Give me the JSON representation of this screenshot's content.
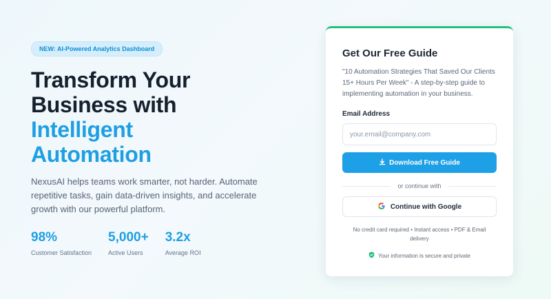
{
  "hero": {
    "badge": "NEW: AI-Powered Analytics Dashboard",
    "headline_line1": "Transform Your",
    "headline_line2": "Business with",
    "headline_accent1": "Intelligent",
    "headline_accent2": "Automation",
    "description": "NexusAI helps teams work smarter, not harder. Automate repetitive tasks, gain data-driven insights, and accelerate growth with our powerful platform.",
    "stats": [
      {
        "value": "98%",
        "label": "Customer Satisfaction"
      },
      {
        "value": "5,000+",
        "label": "Active Users"
      },
      {
        "value": "3.2x",
        "label": "Average ROI"
      }
    ]
  },
  "card": {
    "title": "Get Our Free Guide",
    "description": "\"10 Automation Strategies That Saved Our Clients 15+ Hours Per Week\" - A step-by-step guide to implementing automation in your business.",
    "email_label": "Email Address",
    "email_placeholder": "your.email@company.com",
    "email_value": "",
    "download_label": "Download Free Guide",
    "divider_text": "or continue with",
    "google_label": "Continue with Google",
    "fine_print": "No credit card required • Instant access • PDF & Email delivery",
    "secure_text": "Your information is secure and private"
  },
  "colors": {
    "accent": "#1e9fe3",
    "success": "#22c07e",
    "google_red": "#e94235"
  },
  "icons": {
    "download": "download-icon",
    "google": "google-logo-icon",
    "shield": "shield-check-icon"
  }
}
